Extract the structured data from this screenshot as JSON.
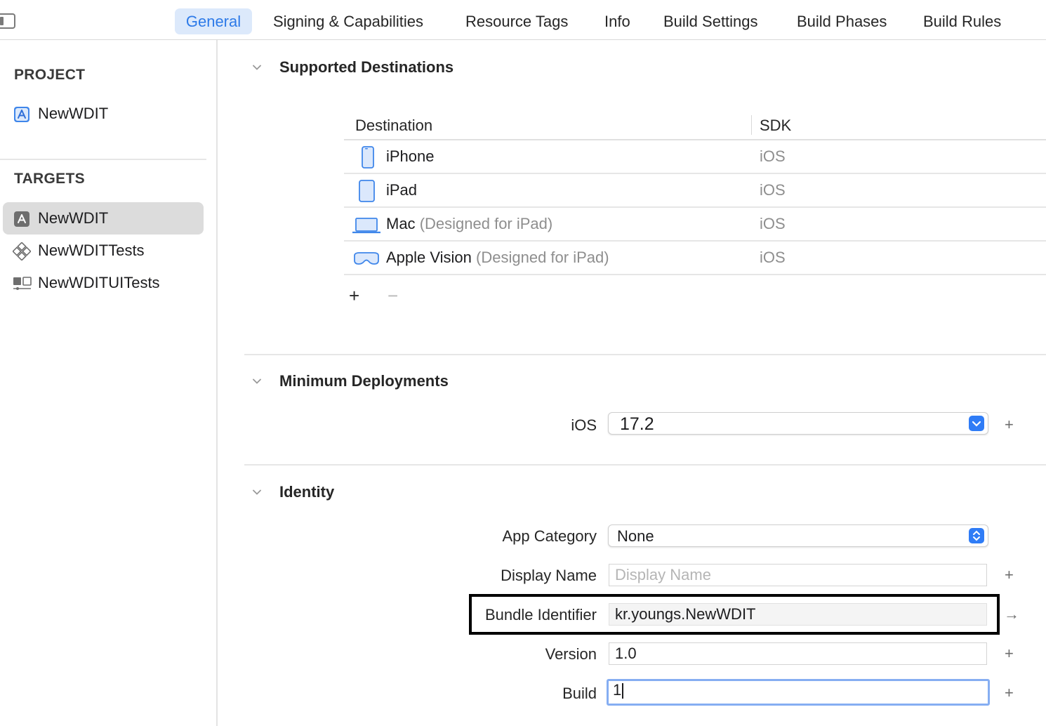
{
  "tabs": [
    {
      "label": "General",
      "selected": true
    },
    {
      "label": "Signing & Capabilities"
    },
    {
      "label": "Resource Tags"
    },
    {
      "label": "Info"
    },
    {
      "label": "Build Settings"
    },
    {
      "label": "Build Phases"
    },
    {
      "label": "Build Rules"
    }
  ],
  "sidebar": {
    "project_header": "PROJECT",
    "project_item": "NewWDIT",
    "targets_header": "TARGETS",
    "targets": [
      {
        "label": "NewWDIT",
        "icon": "app-target-icon",
        "selected": true
      },
      {
        "label": "NewWDITTests",
        "icon": "unit-test-icon"
      },
      {
        "label": "NewWDITUITests",
        "icon": "ui-test-icon"
      }
    ]
  },
  "supported_destinations": {
    "title": "Supported Destinations",
    "columns": [
      "Destination",
      "SDK"
    ],
    "rows": [
      {
        "name": "iPhone",
        "sub": "",
        "sdk": "iOS",
        "icon": "iphone-icon"
      },
      {
        "name": "iPad",
        "sub": "",
        "sdk": "iOS",
        "icon": "ipad-icon"
      },
      {
        "name": "Mac",
        "sub": "(Designed for iPad)",
        "sdk": "iOS",
        "icon": "mac-icon"
      },
      {
        "name": "Apple Vision",
        "sub": "(Designed for iPad)",
        "sdk": "iOS",
        "icon": "vision-pro-icon"
      }
    ],
    "add_label": "+",
    "remove_label": "−"
  },
  "minimum_deployments": {
    "title": "Minimum Deployments",
    "label": "iOS",
    "value": "17.2"
  },
  "identity": {
    "title": "Identity",
    "app_category_label": "App Category",
    "app_category_value": "None",
    "display_name_label": "Display Name",
    "display_name_placeholder": "Display Name",
    "bundle_id_label": "Bundle Identifier",
    "bundle_id_value": "kr.youngs.NewWDIT",
    "version_label": "Version",
    "version_value": "1.0",
    "build_label": "Build",
    "build_value": "1"
  },
  "colors": {
    "accent": "#2f7cf6",
    "selected_tab_bg": "#dce9fb",
    "selected_tab_text": "#2d7ae8"
  }
}
